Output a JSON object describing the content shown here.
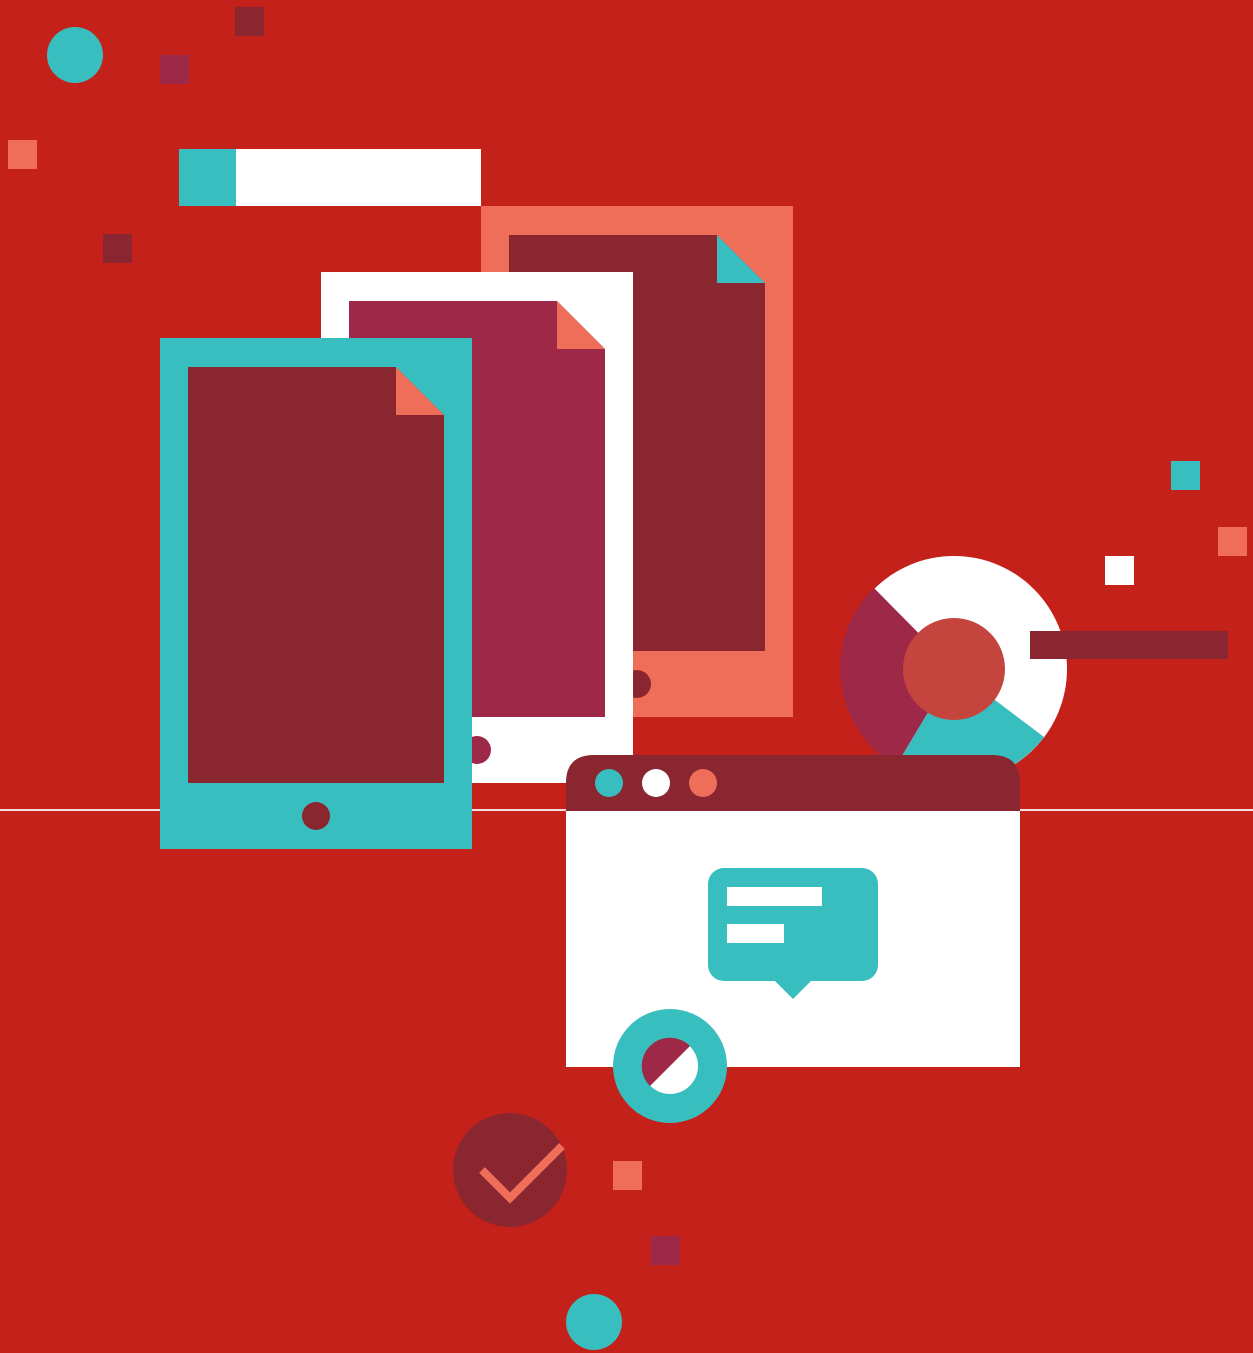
{
  "palette": {
    "background": "#c4211b",
    "teal": "#39bebf",
    "white": "#ffffff",
    "coral": "#ef6e5a",
    "maroon": "#8a2630",
    "plum": "#9d2848",
    "rust": "#c3453d"
  },
  "scene": {
    "description_icons": [
      "tablet-teal-icon",
      "tablet-white-icon",
      "tablet-coral-icon",
      "browser-window-icon",
      "chat-bubble-icon",
      "donut-chart-icon",
      "progress-ring-icon",
      "checkmark-badge-icon",
      "search-bar-icon"
    ]
  }
}
